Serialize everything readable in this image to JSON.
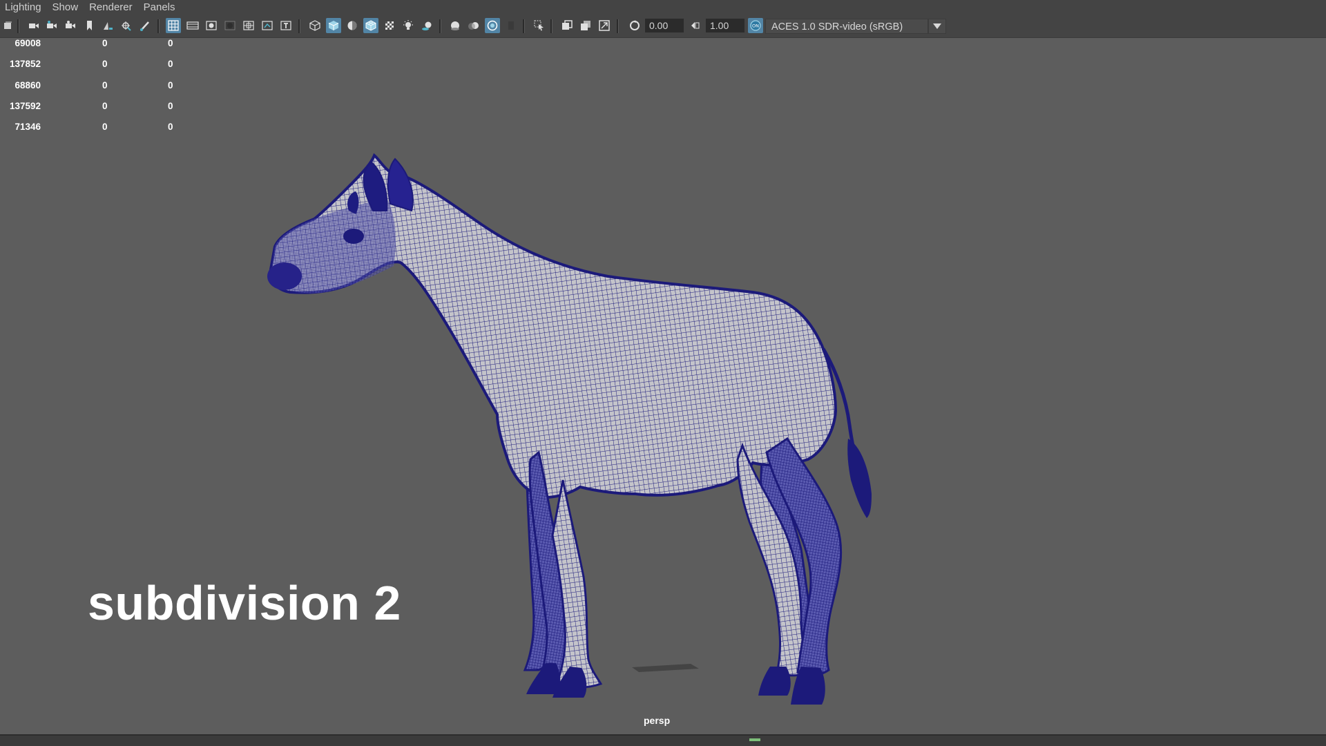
{
  "menubar": {
    "items": [
      "Lighting",
      "Show",
      "Renderer",
      "Panels"
    ]
  },
  "toolbar": {
    "exposure_value": "0.00",
    "gamma_value": "1.00",
    "color_space": "ACES 1.0 SDR-video (sRGB)",
    "icons": [
      "select-camera-icon",
      "camera-attributes-icon",
      "camera-bookmark-icon",
      "image-plane-icon",
      "2d-pan-zoom-icon",
      "grease-pencil-icon",
      "grid-icon",
      "film-gate-icon",
      "resolution-gate-icon",
      "gate-mask-icon",
      "field-chart-icon",
      "safe-action-icon",
      "safe-title-icon",
      "wireframe-icon",
      "smooth-shade-icon",
      "use-default-material-icon",
      "wireframe-on-shaded-icon",
      "textured-icon",
      "use-all-lights-icon",
      "shadows-icon",
      "screen-space-ao-icon",
      "motion-blur-icon",
      "anti-aliasing-icon",
      "depth-of-field-icon",
      "isolate-select-icon",
      "xray-icon",
      "xray-joints-icon",
      "xray-components-icon",
      "exposure-icon",
      "gamma-icon",
      "color-management-icon",
      "dropdown-arrow-icon"
    ]
  },
  "hud": {
    "rows": [
      [
        "69008",
        "0",
        "0"
      ],
      [
        "137852",
        "0",
        "0"
      ],
      [
        "68860",
        "0",
        "0"
      ],
      [
        "137592",
        "0",
        "0"
      ],
      [
        "71346",
        "0",
        "0"
      ]
    ]
  },
  "viewport": {
    "overlay_text": "subdivision 2",
    "camera_label": "persp",
    "wire_color": "#1c1a7a",
    "background_color": "#5d5d5d"
  },
  "colors": {
    "menu_bg": "#444444",
    "active_button": "#5285a6",
    "text": "#ffffff"
  }
}
